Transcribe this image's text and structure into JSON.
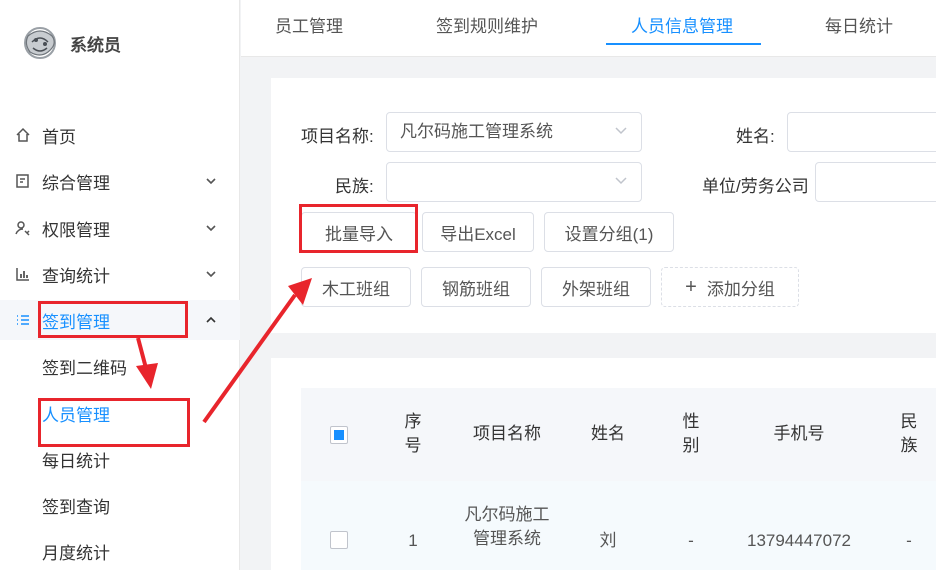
{
  "app": {
    "name": "系统员"
  },
  "sidebar": {
    "items": [
      {
        "label": "首页",
        "icon": "home-icon"
      },
      {
        "label": "综合管理",
        "icon": "window-icon"
      },
      {
        "label": "权限管理",
        "icon": "user-key-icon"
      },
      {
        "label": "查询统计",
        "icon": "bar-chart-icon"
      },
      {
        "label": "签到管理",
        "icon": "list-icon",
        "expanded": true
      }
    ],
    "subitems": [
      {
        "label": "签到二维码"
      },
      {
        "label": "人员管理",
        "active": true
      },
      {
        "label": "每日统计"
      },
      {
        "label": "签到查询"
      },
      {
        "label": "月度统计"
      }
    ]
  },
  "tabs": [
    {
      "label": "员工管理"
    },
    {
      "label": "签到规则维护"
    },
    {
      "label": "人员信息管理",
      "active": true
    },
    {
      "label": "每日统计"
    }
  ],
  "filters": {
    "project_label": "项目名称:",
    "project_value": "凡尔码施工管理系统",
    "name_label": "姓名:",
    "name_value": "",
    "nation_label": "民族:",
    "nation_value": "",
    "company_label": "单位/劳务公司",
    "company_value": ""
  },
  "actions": {
    "batch_import": "批量导入",
    "export_excel": "导出Excel",
    "set_group": "设置分组(1)"
  },
  "groups": {
    "items": [
      "木工班组",
      "钢筋班组",
      "外架班组"
    ],
    "add_label": "添加分组",
    "add_symbol": "+"
  },
  "table": {
    "headers": {
      "index": "序号",
      "project": "项目名称",
      "name": "姓名",
      "gender": "性别",
      "phone": "手机号",
      "nation": "民族"
    },
    "rows": [
      {
        "index": "1",
        "project": "凡尔码施工管理系统",
        "name": "刘",
        "gender": "-",
        "phone": "13794447072",
        "nation": "-"
      }
    ]
  },
  "colors": {
    "accent": "#1890ff",
    "annotation": "#e8252c"
  }
}
